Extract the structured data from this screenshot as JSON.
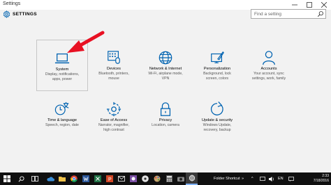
{
  "window": {
    "title": "Settings"
  },
  "header": {
    "title": "SETTINGS"
  },
  "search": {
    "placeholder": "Find a setting"
  },
  "tiles": [
    {
      "label": "System",
      "desc_1": "Display, notifications,",
      "desc_2": "apps, power",
      "icon": "laptop-icon"
    },
    {
      "label": "Devices",
      "desc_1": "Bluetooth, printers,",
      "desc_2": "mouse",
      "icon": "keyboard-icon"
    },
    {
      "label": "Network & Internet",
      "desc_1": "Wi-Fi, airplane mode,",
      "desc_2": "VPN",
      "icon": "globe-icon"
    },
    {
      "label": "Personalization",
      "desc_1": "Background, lock",
      "desc_2": "screen, colors",
      "icon": "paint-icon"
    },
    {
      "label": "Accounts",
      "desc_1": "Your account, sync",
      "desc_2": "settings, work, family",
      "icon": "person-icon"
    },
    {
      "label": "Time & language",
      "desc_1": "Speech, region, date",
      "desc_2": "",
      "icon": "clock-language-icon"
    },
    {
      "label": "Ease of Access",
      "desc_1": "Narrator, magnifier,",
      "desc_2": "high contrast",
      "icon": "ease-of-access-icon"
    },
    {
      "label": "Privacy",
      "desc_1": "Location, camera",
      "desc_2": "",
      "icon": "lock-icon"
    },
    {
      "label": "Update & security",
      "desc_1": "Windows Update,",
      "desc_2": "recovery, backup",
      "icon": "refresh-icon"
    }
  ],
  "taskbar": {
    "folder_shortcut": "Folder Shortcut",
    "lang": "EN",
    "time": "2:33",
    "date": "7/18/2016"
  },
  "colors": {
    "accent": "#0063b1",
    "arrow": "#e81123",
    "taskbar": "#101010"
  }
}
